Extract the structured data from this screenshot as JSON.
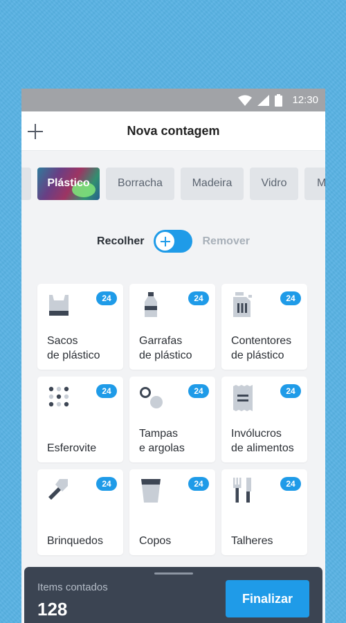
{
  "status_bar": {
    "time": "12:30",
    "icons": [
      "wifi-icon",
      "signal-icon",
      "battery-icon"
    ]
  },
  "app_bar": {
    "title": "Nova contagem",
    "left_icon": "plus-icon"
  },
  "categories": [
    {
      "label": "",
      "state": "partial"
    },
    {
      "label": "Plástico",
      "state": "selected"
    },
    {
      "label": "Borracha",
      "state": "default"
    },
    {
      "label": "Madeira",
      "state": "default"
    },
    {
      "label": "Vidro",
      "state": "default"
    },
    {
      "label": "M",
      "state": "partial"
    }
  ],
  "mode_toggle": {
    "left_label": "Recolher",
    "right_label": "Remover",
    "active": "Recolher"
  },
  "items": [
    {
      "name": "Sacos\nde plástico",
      "count": "24",
      "icon": "plastic-bag-icon"
    },
    {
      "name": "Garrafas\nde plástico",
      "count": "24",
      "icon": "bottle-icon"
    },
    {
      "name": "Contentores\nde plástico",
      "count": "24",
      "icon": "jerrycan-icon"
    },
    {
      "name": "Esferovite",
      "count": "24",
      "icon": "styrofoam-icon"
    },
    {
      "name": "Tampas\ne argolas",
      "count": "24",
      "icon": "caps-rings-icon"
    },
    {
      "name": "Invólucros\nde alimentos",
      "count": "24",
      "icon": "food-wrapper-icon"
    },
    {
      "name": "Brinquedos",
      "count": "24",
      "icon": "toy-shovel-icon"
    },
    {
      "name": "Copos",
      "count": "24",
      "icon": "cup-icon"
    },
    {
      "name": "Talheres",
      "count": "24",
      "icon": "cutlery-icon"
    }
  ],
  "footer": {
    "caption": "Items contados",
    "total": "128",
    "finish_label": "Finalizar"
  },
  "colors": {
    "accent": "#1f9be8",
    "footer_bg": "#3b4452",
    "background": "#58b2e3"
  }
}
